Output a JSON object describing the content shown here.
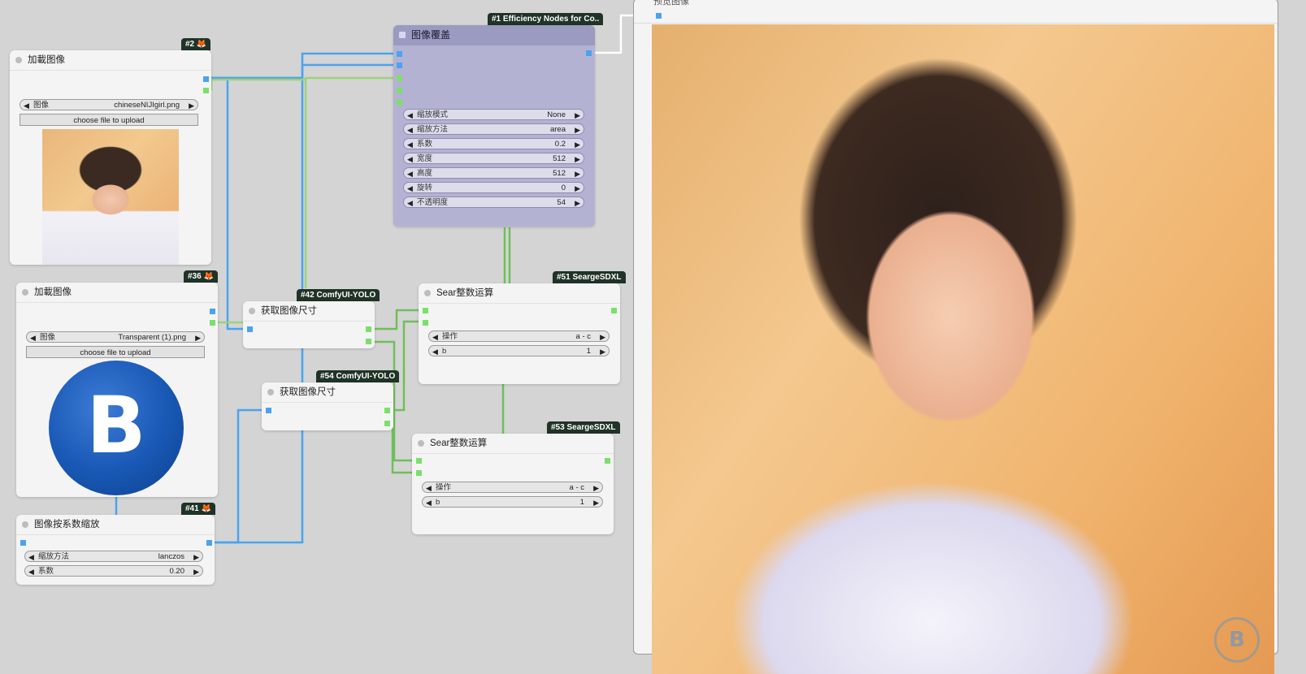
{
  "nodes": {
    "load1": {
      "badge": "#2 🦊",
      "title": "加載图像",
      "image_label": "图像",
      "image_value": "chineseNIJIgirl.png",
      "upload_label": "choose file to upload"
    },
    "load2": {
      "badge": "#36 🦊",
      "title": "加載图像",
      "image_label": "图像",
      "image_value": "Transparent (1).png",
      "upload_label": "choose file to upload"
    },
    "scale": {
      "badge": "#41 🦊",
      "title": "图像按系数缩放",
      "w1_label": "缩放方法",
      "w1_value": "lanczos",
      "w2_label": "系数",
      "w2_value": "0.20"
    },
    "size42": {
      "badge": "#42 ComfyUI-YOLO",
      "title": "获取图像尺寸"
    },
    "size54": {
      "badge": "#54 ComfyUI-YOLO",
      "title": "获取图像尺寸"
    },
    "overlay": {
      "badge": "#1 Efficiency Nodes for Co..",
      "title": "图像覆盖",
      "widgets": [
        {
          "label": "缩放模式",
          "value": "None"
        },
        {
          "label": "缩放方法",
          "value": "area"
        },
        {
          "label": "系数",
          "value": "0.2"
        },
        {
          "label": "宽度",
          "value": "512"
        },
        {
          "label": "高度",
          "value": "512"
        },
        {
          "label": "旋转",
          "value": "0"
        },
        {
          "label": "不透明度",
          "value": "54"
        }
      ]
    },
    "sear51": {
      "badge": "#51 SeargeSDXL",
      "title": "Sear整数运算",
      "w1_label": "操作",
      "w1_value": "a - c",
      "w2_label": "b",
      "w2_value": "1"
    },
    "sear53": {
      "badge": "#53 SeargeSDXL",
      "title": "Sear整数运算",
      "w1_label": "操作",
      "w1_value": "a - c",
      "w2_label": "b",
      "w2_value": "1"
    }
  },
  "preview": {
    "title": "预览图像"
  },
  "logo_letter": "B",
  "colors": {
    "image_wire": "#4aa3f0",
    "int_wire": "#6fbf5a",
    "mask_wire": "#9ed27a",
    "output_wire": "#ffffff",
    "overlay_node": "#b3b2d3"
  }
}
